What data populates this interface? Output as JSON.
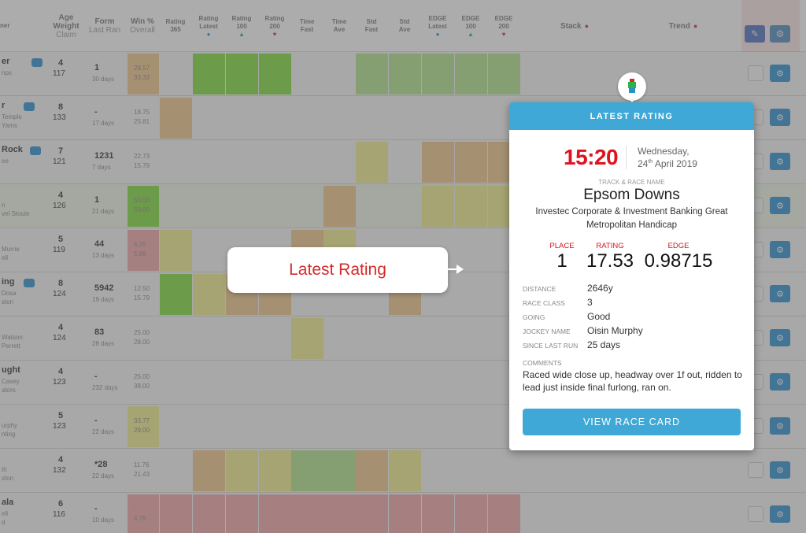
{
  "header": {
    "columns": [
      {
        "line1": "Age",
        "line2": "Weight",
        "line3": "Claim"
      },
      {
        "line1": "Form",
        "line2": "Last Ran"
      },
      {
        "line1": "Win %",
        "line2": "Overall"
      },
      {
        "line1": "Rating",
        "line2": "365"
      },
      {
        "line1": "Rating",
        "line2": "Latest"
      },
      {
        "line1": "Rating",
        "line2": "100"
      },
      {
        "line1": "Rating",
        "line2": "200"
      },
      {
        "line1": "Time",
        "line2": "Fast"
      },
      {
        "line1": "Time",
        "line2": "Ave"
      },
      {
        "line1": "Std",
        "line2": "Fast"
      },
      {
        "line1": "Std",
        "line2": "Ave"
      },
      {
        "line1": "EDGE",
        "line2": "Latest"
      },
      {
        "line1": "EDGE",
        "line2": "100"
      },
      {
        "line1": "EDGE",
        "line2": "200"
      }
    ],
    "stack_label": "Stack",
    "trend_label": "Trend",
    "partial_left": "ner"
  },
  "rows": [
    {
      "name": "er",
      "sub": "nps",
      "age": "4",
      "weight": "117",
      "form": "1",
      "last": "30 days",
      "win": "28.57",
      "win2": "33.33"
    },
    {
      "name": "r",
      "sub": "Temple",
      "sub2": "Yams",
      "age": "8",
      "weight": "133",
      "form": "-",
      "last": "17 days",
      "win": "18.75",
      "win2": "25.81"
    },
    {
      "name": "Rock",
      "sub": "ee",
      "age": "7",
      "weight": "121",
      "form": "1231",
      "last": "7 days",
      "win": "22.73",
      "win2": "15.79"
    },
    {
      "name": "",
      "sub": "n",
      "sub2": "vel Stoute",
      "age": "4",
      "weight": "126",
      "form": "1",
      "last": "21 days",
      "win": "50.00",
      "win2": "50.00"
    },
    {
      "name": "",
      "sub": "Murrie",
      "sub2": "ell",
      "age": "5",
      "weight": "119",
      "form": "44",
      "last": "13 days",
      "win": "6.25",
      "win2": "5.88"
    },
    {
      "name": "ing",
      "sub": "Dosa",
      "sub2": "ston",
      "age": "8",
      "weight": "124",
      "form": "5942",
      "last": "19 days",
      "win": "12.50",
      "win2": "15.79"
    },
    {
      "name": "",
      "sub": "Watson",
      "sub2": "Perrett",
      "age": "4",
      "weight": "124",
      "form": "83",
      "last": "28 days",
      "win": "25.00",
      "win2": "28.00"
    },
    {
      "name": "ught",
      "sub": "Casey",
      "sub2": "ators",
      "age": "4",
      "weight": "123",
      "form": "-",
      "last": "232 days",
      "win": "25.00",
      "win2": "38.00"
    },
    {
      "name": "",
      "sub": "urphy",
      "sub2": "nting",
      "age": "5",
      "weight": "123",
      "form": "-",
      "last": "22 days",
      "win": "33.77",
      "win2": "29.00"
    },
    {
      "name": "",
      "sub": "th",
      "sub2": "ston",
      "age": "4",
      "weight": "132",
      "form": "*28",
      "last": "22 days",
      "win": "11.76",
      "win2": "21.43"
    },
    {
      "name": "ala",
      "sub": "ell",
      "sub2": "d",
      "age": "6",
      "weight": "116",
      "form": "-",
      "last": "10 days",
      "win": "-",
      "win2": "4.76"
    }
  ],
  "callout": {
    "text": "Latest Rating"
  },
  "popup": {
    "title": "LATEST RATING",
    "time": "15:20",
    "day": "Wednesday,",
    "date_num": "24",
    "date_suffix": "th",
    "date_rest": " April 2019",
    "track_label": "TRACK & RACE NAME",
    "track": "Epsom Downs",
    "race_name": "Investec Corporate & Investment Banking Great Metropolitan Handicap",
    "place_label": "PLACE",
    "place": "1",
    "rating_label": "RATING",
    "rating": "17.53",
    "edge_label": "EDGE",
    "edge": "0.98715",
    "details": [
      {
        "label": "DISTANCE",
        "value": "2646y"
      },
      {
        "label": "RACE CLASS",
        "value": "3"
      },
      {
        "label": "GOING",
        "value": "Good"
      },
      {
        "label": "JOCKEY NAME",
        "value": "Oisin Murphy"
      },
      {
        "label": "SINCE LAST RUN",
        "value": "25 days"
      }
    ],
    "comments_label": "COMMENTS",
    "comments": "Raced wide close up, headway over 1f out, ridden to lead just inside final furlong, ran on.",
    "button": "VIEW RACE CARD"
  },
  "colors": {
    "green": "#7fdc3a",
    "lightgreen": "#b3e58a",
    "yellow": "#f0ee8a",
    "orange": "#f2c68a",
    "red": "#f2a6a6",
    "accent": "#3fa8d6",
    "time_red": "#e0121e"
  }
}
